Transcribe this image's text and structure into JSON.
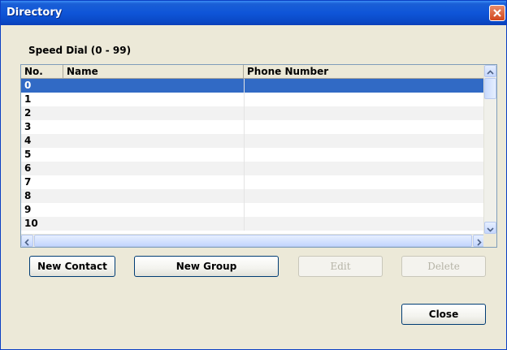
{
  "window": {
    "title": "Directory"
  },
  "group": {
    "label": "Speed Dial (0 - 99)"
  },
  "table": {
    "columns": [
      "No.",
      "Name",
      "Phone Number"
    ],
    "rows": [
      {
        "no": "0",
        "name": "",
        "phone": ""
      },
      {
        "no": "1",
        "name": "",
        "phone": ""
      },
      {
        "no": "2",
        "name": "",
        "phone": ""
      },
      {
        "no": "3",
        "name": "",
        "phone": ""
      },
      {
        "no": "4",
        "name": "",
        "phone": ""
      },
      {
        "no": "5",
        "name": "",
        "phone": ""
      },
      {
        "no": "6",
        "name": "",
        "phone": ""
      },
      {
        "no": "7",
        "name": "",
        "phone": ""
      },
      {
        "no": "8",
        "name": "",
        "phone": ""
      },
      {
        "no": "9",
        "name": "",
        "phone": ""
      },
      {
        "no": "10",
        "name": "",
        "phone": ""
      }
    ],
    "selected_index": 0
  },
  "buttons": {
    "new_contact": "New Contact",
    "new_group": "New Group",
    "edit": "Edit",
    "delete": "Delete",
    "close": "Close"
  },
  "colors": {
    "titlebar": "#0a49c6",
    "selection": "#316ac5",
    "window_bg": "#ece9d8",
    "close_btn": "#d2461d"
  },
  "icons": [
    "close-icon",
    "scroll-up-icon",
    "scroll-down-icon",
    "scroll-left-icon",
    "scroll-right-icon"
  ]
}
